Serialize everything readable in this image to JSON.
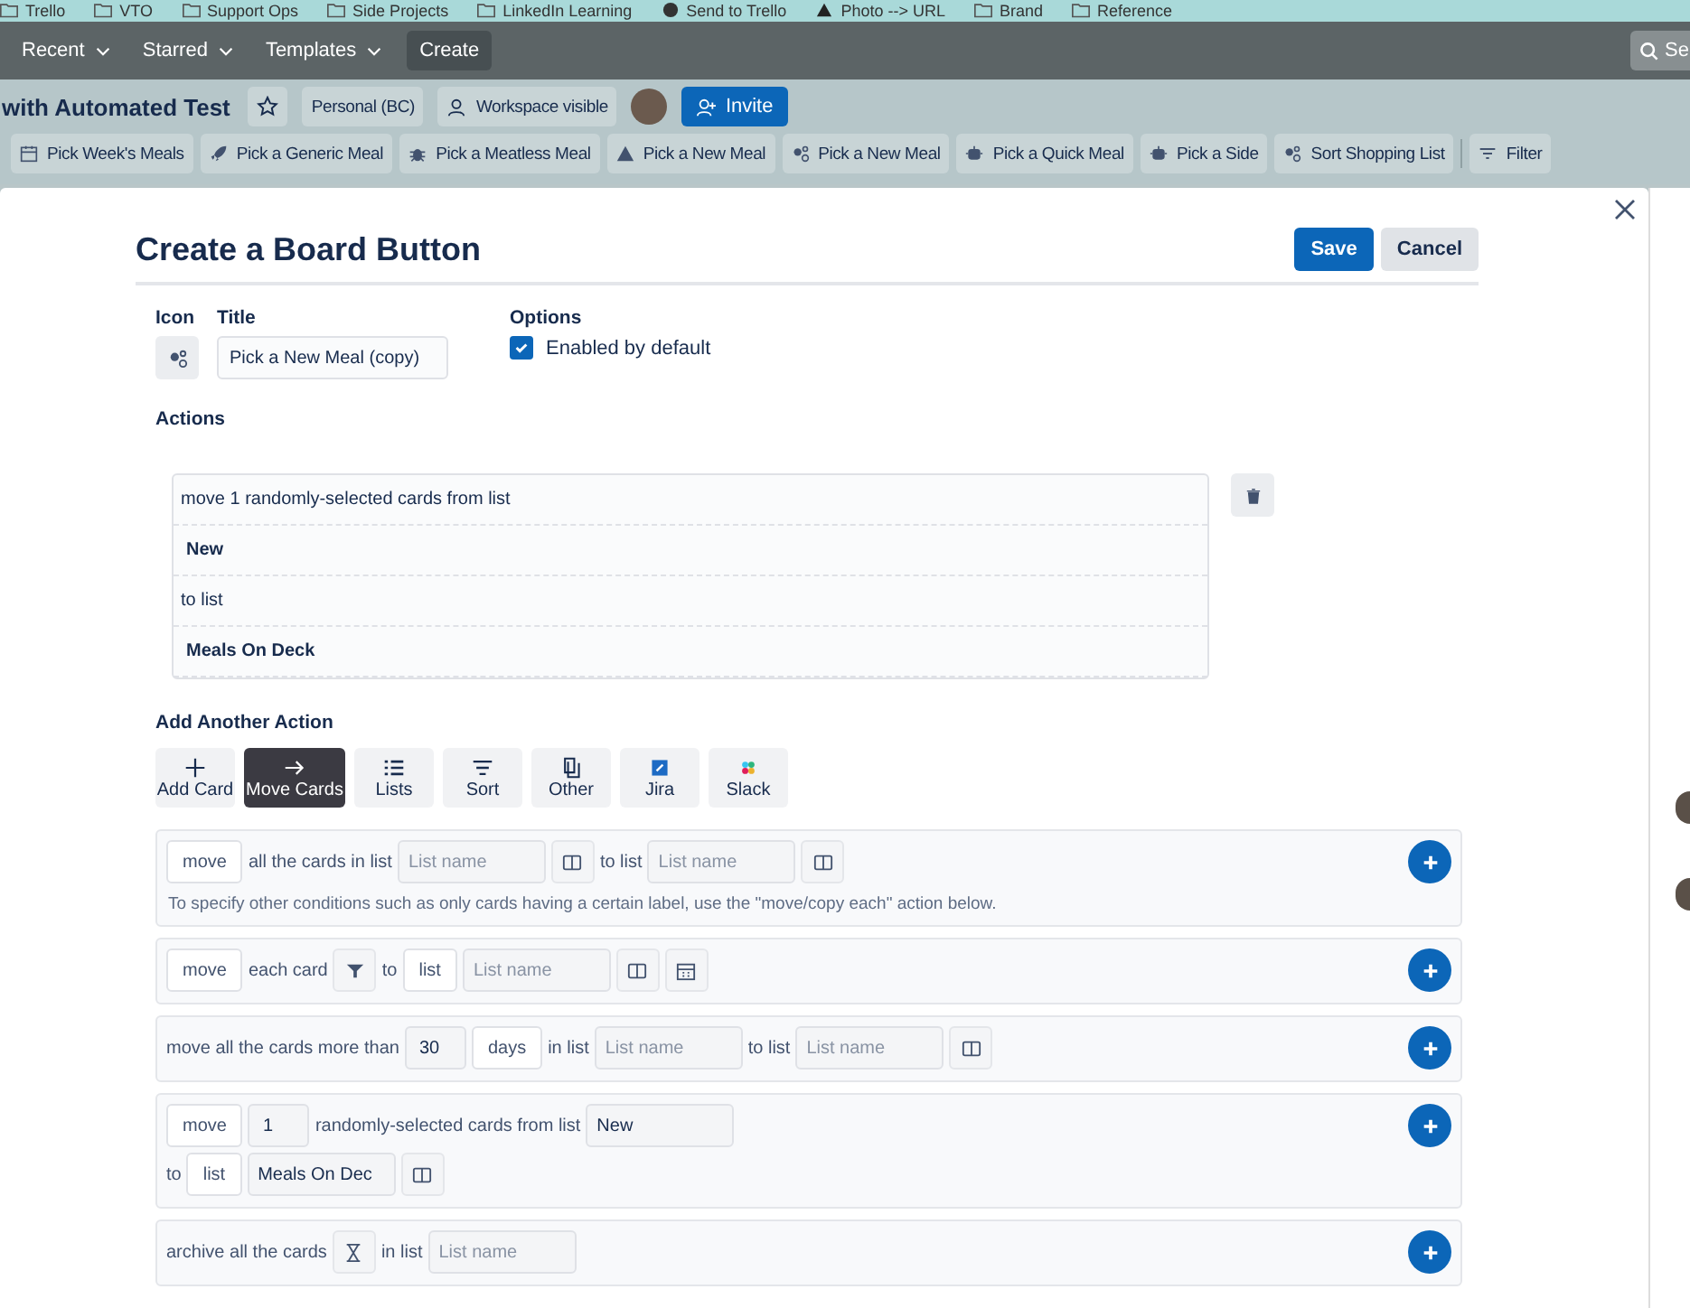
{
  "bookmarks": [
    {
      "label": "Trello",
      "kind": "folder"
    },
    {
      "label": "VTO",
      "kind": "folder"
    },
    {
      "label": "Support Ops",
      "kind": "folder"
    },
    {
      "label": "Side Projects",
      "kind": "folder"
    },
    {
      "label": "LinkedIn Learning",
      "kind": "folder"
    },
    {
      "label": "Send to Trello",
      "kind": "globe"
    },
    {
      "label": "Photo --> URL",
      "kind": "triangle"
    },
    {
      "label": "Brand",
      "kind": "folder"
    },
    {
      "label": "Reference",
      "kind": "folder"
    }
  ],
  "nav": {
    "menus": [
      "Recent",
      "Starred",
      "Templates"
    ],
    "create": "Create",
    "search": "Se"
  },
  "board": {
    "title": "with Automated Test",
    "privacy": "Personal (BC)",
    "visibility": "Workspace visible",
    "invite": "Invite"
  },
  "board_buttons": [
    {
      "label": "Pick Week's Meals",
      "kind": "calendar"
    },
    {
      "label": "Pick a Generic Meal",
      "kind": "rocket"
    },
    {
      "label": "Pick a Meatless Meal",
      "kind": "bug"
    },
    {
      "label": "Pick a New Meal",
      "kind": "warning"
    },
    {
      "label": "Pick a New Meal",
      "kind": "gears"
    },
    {
      "label": "Pick a Quick Meal",
      "kind": "robot"
    },
    {
      "label": "Pick a Side",
      "kind": "robot"
    },
    {
      "label": "Sort Shopping List",
      "kind": "gears"
    }
  ],
  "filter": "Filter",
  "dialog": {
    "title": "Create a Board Button",
    "save": "Save",
    "cancel": "Cancel",
    "icon_label": "Icon",
    "title_label": "Title",
    "title_value": "Pick a New Meal (copy)",
    "options_label": "Options",
    "enabled": {
      "label": "Enabled by default",
      "checked": true
    },
    "actions_label": "Actions",
    "actions": [
      {
        "text": "move 1 randomly-selected cards from list",
        "bold": false
      },
      {
        "text": "New",
        "bold": true
      },
      {
        "text": "to list",
        "bold": false
      },
      {
        "text": "Meals On Deck",
        "bold": true
      }
    ],
    "add_label": "Add Another Action",
    "categories": [
      {
        "label": "Add Card",
        "kind": "plus",
        "selected": false
      },
      {
        "label": "Move Cards",
        "kind": "arrow",
        "selected": true
      },
      {
        "label": "Lists",
        "kind": "list",
        "selected": false
      },
      {
        "label": "Sort",
        "kind": "sort",
        "selected": false
      },
      {
        "label": "Other",
        "kind": "copy",
        "selected": false
      },
      {
        "label": "Jira",
        "kind": "jira",
        "selected": false
      },
      {
        "label": "Slack",
        "kind": "slack",
        "selected": false
      }
    ],
    "rows": [
      {
        "lines": [
          [
            {
              "kind": "button",
              "text": "move"
            },
            {
              "kind": "text",
              "text": "all the cards in list"
            },
            {
              "kind": "field",
              "placeholder": "List name"
            },
            {
              "kind": "board"
            },
            {
              "kind": "text",
              "text": "to list"
            },
            {
              "kind": "field",
              "placeholder": "List name"
            },
            {
              "kind": "board"
            }
          ]
        ],
        "note": "To specify other conditions such as only cards having a certain label, use the \"move/copy each\" action below."
      },
      {
        "lines": [
          [
            {
              "kind": "button",
              "text": "move"
            },
            {
              "kind": "text",
              "text": "each card"
            },
            {
              "kind": "filter"
            },
            {
              "kind": "text",
              "text": "to"
            },
            {
              "kind": "button",
              "text": "list"
            },
            {
              "kind": "field",
              "placeholder": "List name"
            },
            {
              "kind": "board"
            },
            {
              "kind": "calendar"
            }
          ]
        ]
      },
      {
        "lines": [
          [
            {
              "kind": "text",
              "text": "move all the cards more than"
            },
            {
              "kind": "value",
              "text": "30"
            },
            {
              "kind": "button",
              "text": "days"
            },
            {
              "kind": "text",
              "text": "in list"
            },
            {
              "kind": "field",
              "placeholder": "List name"
            },
            {
              "kind": "text",
              "text": "to list"
            },
            {
              "kind": "field",
              "placeholder": "List name"
            },
            {
              "kind": "board"
            }
          ]
        ]
      },
      {
        "lines": [
          [
            {
              "kind": "button",
              "text": "move"
            },
            {
              "kind": "value",
              "text": "1"
            },
            {
              "kind": "text",
              "text": "randomly-selected cards from list"
            },
            {
              "kind": "field",
              "value": "New"
            }
          ],
          [
            {
              "kind": "text",
              "text": "to"
            },
            {
              "kind": "button",
              "text": "list"
            },
            {
              "kind": "field",
              "value": "Meals On Dec"
            },
            {
              "kind": "board"
            }
          ]
        ]
      },
      {
        "lines": [
          [
            {
              "kind": "text",
              "text": "archive all the cards"
            },
            {
              "kind": "hourglass"
            },
            {
              "kind": "text",
              "text": "in list"
            },
            {
              "kind": "field",
              "placeholder": "List name"
            }
          ]
        ]
      }
    ]
  }
}
